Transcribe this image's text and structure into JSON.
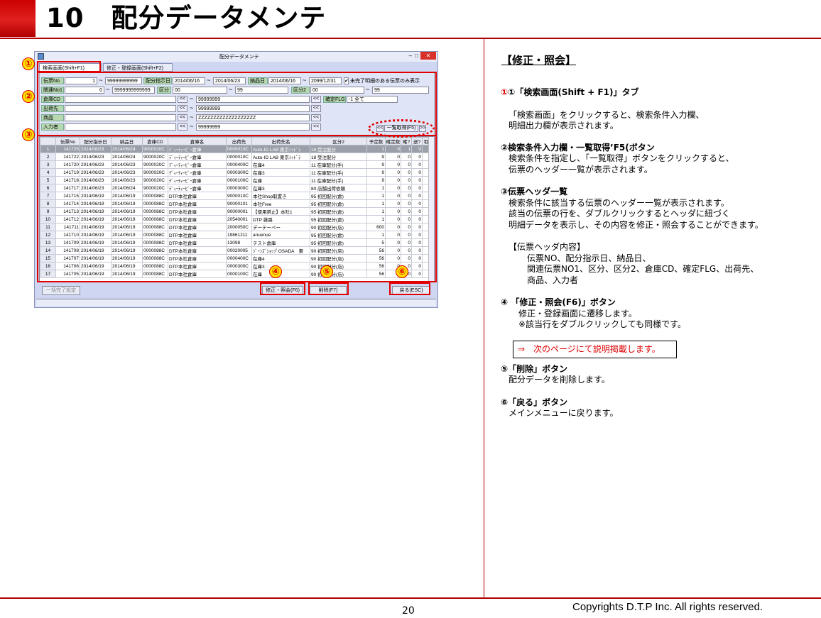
{
  "header": {
    "title": "10　配分データメンテ"
  },
  "footer": {
    "page": "20",
    "copyright": "Copyrights  D.T.P Inc. All rights reserved."
  },
  "window": {
    "title": "配分データメンテ",
    "tabs": [
      "検索画面(Shift+F1)",
      "修正・登録画面(Shift+F2)"
    ],
    "form": {
      "denpyo_label": "伝票No",
      "denpyo_from": "1",
      "denpyo_to": "99999999999",
      "haibun_label": "配分指示日",
      "haibun_from": "2014/06/16",
      "haibun_to": "2014/06/23",
      "nouhin_label": "納品日",
      "nouhin_from": "2014/06/16",
      "nouhin_to": "2099/12/31",
      "check_label": "未完了明細のある伝票のみ表示",
      "kanren_label": "関連No1",
      "kanren_from": "0",
      "kanren_to": "9999999999999",
      "kubun_label": "区分",
      "kubun_from": "00",
      "kubun_to": "99",
      "kubun2_label": "区分2",
      "kubun2_from": "00",
      "kubun2_to": "99",
      "souko_label": "倉庫CD",
      "souko_to": "99999999",
      "kakutei_label": "確定FLG",
      "kakutei_value": "-1 全て",
      "shukka_label": "出荷先",
      "shukka_to": "99999999",
      "shohin_label": "商品",
      "shohin_to": "ZZZZZZZZZZZZZZZZZZZ",
      "nyuryoku_label": "入力者",
      "nyuryoku_to": "99999999",
      "prev": "<<",
      "next": ">>",
      "search_btn": "一覧取得(F5)"
    },
    "grid": {
      "headers": [
        "",
        "伝票No",
        "配分指示日",
        "納品日",
        "倉庫CD",
        "倉庫名",
        "出荷先",
        "出荷先名",
        "区分2",
        "予定数",
        "確定数",
        "確?",
        "送?",
        "取?"
      ],
      "rows": [
        [
          "1",
          "141725",
          "2014/06/23",
          "2014/06/24",
          "9000020C",
          "ﾃﾞｨｰﾃｨｰﾋﾟｰ倉庫",
          "0000010C",
          "Auto-ID LAB 東京ﾐｯﾄﾞﾗ",
          "18 受注配分",
          "1",
          "0",
          "1",
          "0",
          "0"
        ],
        [
          "2",
          "141722",
          "2014/06/23",
          "2014/06/24",
          "9000020C",
          "ﾃﾞｨｰﾃｨｰﾋﾟｰ倉庫",
          "0000010C",
          "Auto-ID LAB 東京ﾐｯﾄﾞﾗ",
          "18 受注配分",
          "9",
          "0",
          "0",
          "0",
          "0"
        ],
        [
          "3",
          "141720",
          "2014/06/23",
          "2014/06/23",
          "9000020C",
          "ﾃﾞｨｰﾃｨｰﾋﾟｰ倉庫",
          "0000400C",
          "在庫4",
          "11 在庫配分(手)",
          "9",
          "0",
          "0",
          "0",
          "0"
        ],
        [
          "4",
          "141719",
          "2014/06/23",
          "2014/06/23",
          "9000020C",
          "ﾃﾞｨｰﾃｨｰﾋﾟｰ倉庫",
          "0000300C",
          "在庫3",
          "11 在庫配分(手)",
          "9",
          "0",
          "0",
          "0",
          "0"
        ],
        [
          "5",
          "141718",
          "2014/06/23",
          "2014/06/23",
          "9000020C",
          "ﾃﾞｨｰﾃｨｰﾋﾟｰ倉庫",
          "0000100C",
          "在庫",
          "11 在庫配分(手)",
          "9",
          "0",
          "0",
          "0",
          "0"
        ],
        [
          "6",
          "141717",
          "2014/06/23",
          "2014/06/24",
          "9000020C",
          "ﾃﾞｨｰﾃｨｰﾋﾟｰ倉庫",
          "0000300C",
          "在庫3",
          "80 店舗出荷依頼",
          "1",
          "0",
          "0",
          "0",
          "0"
        ],
        [
          "7",
          "141715",
          "2014/06/19",
          "2014/06/19",
          "0000088C",
          "DTP本社倉庫",
          "9000010C",
          "本社Shop取置き",
          "95 初回配分(倉)",
          "1",
          "0",
          "0",
          "0",
          "0"
        ],
        [
          "8",
          "141714",
          "2014/06/19",
          "2014/06/19",
          "0000088C",
          "DTP本社倉庫",
          "90000101",
          "本社Free",
          "95 初回配分(倉)",
          "1",
          "0",
          "0",
          "0",
          "0"
        ],
        [
          "9",
          "141713",
          "2014/06/19",
          "2014/06/19",
          "0000088C",
          "DTP本社倉庫",
          "90000001",
          "【使用禁止】本社1",
          "95 初回配分(倉)",
          "1",
          "0",
          "0",
          "0",
          "0"
        ],
        [
          "10",
          "141712",
          "2014/06/19",
          "2014/06/19",
          "0000088C",
          "DTP本社倉庫",
          "20540001",
          "DTP 雑路",
          "95 初回配分(倉)",
          "1",
          "0",
          "0",
          "0",
          "0"
        ],
        [
          "11",
          "141711",
          "2014/06/19",
          "2014/06/19",
          "0000088C",
          "DTP本社倉庫",
          "2000050C",
          "デーテーペー",
          "90 初回配分(店)",
          "600",
          "0",
          "0",
          "0",
          "0"
        ],
        [
          "12",
          "141710",
          "2014/06/19",
          "2014/06/19",
          "0000088C",
          "DTP本社倉庫",
          "19861211",
          "anuenue",
          "95 初回配分(倉)",
          "1",
          "0",
          "0",
          "0",
          "0"
        ],
        [
          "13",
          "141709",
          "2014/06/19",
          "2014/06/19",
          "0000088C",
          "DTP本社倉庫",
          "13098",
          "テスト倉庫",
          "95 初回配分(倉)",
          "5",
          "0",
          "0",
          "0",
          "0"
        ],
        [
          "14",
          "141708",
          "2014/06/19",
          "2014/06/19",
          "0000088C",
          "DTP本社倉庫",
          "00020005",
          "ｼﾞｰﾝｽﾞｼｮｯﾌﾟOSADA　東",
          "90 初回配分(店)",
          "56",
          "0",
          "0",
          "0",
          "0"
        ],
        [
          "15",
          "141707",
          "2014/06/19",
          "2014/06/19",
          "0000088C",
          "DTP本社倉庫",
          "0000400C",
          "在庫4",
          "90 初回配分(店)",
          "56",
          "0",
          "0",
          "0",
          "0"
        ],
        [
          "16",
          "141706",
          "2014/06/19",
          "2014/06/19",
          "0000088C",
          "DTP本社倉庫",
          "0000300C",
          "在庫3",
          "90 初回配分(店)",
          "56",
          "0",
          "0",
          "0",
          "0"
        ],
        [
          "17",
          "141705",
          "2014/06/19",
          "2014/06/19",
          "0000088C",
          "DTP本社倉庫",
          "0000100C",
          "在庫",
          "90 初回配分(店)",
          "56",
          "0",
          "0",
          "0",
          "0"
        ]
      ]
    },
    "buttons": {
      "ikkatsu": "一括完了設定",
      "shusei": "修正・照会(F6)",
      "sakujo": "削除(F7)",
      "modoru": "戻る(ESC)"
    },
    "markers": [
      "①",
      "②",
      "③",
      "④",
      "⑤",
      "⑥"
    ]
  },
  "explain": {
    "heading": "【修正・照会】",
    "s1_title": "①「検索画面(Shift + F1)」タブ",
    "s1_l1": "「検索画面」をクリックすると、検索条件入力欄、",
    "s1_l2": "明細出力欄が表示されます。",
    "s2_title": "②検索条件入力欄・一覧取得’F5(ボタン",
    "s2_l1": "検索条件を指定し、「一覧取得」ボタンをクリックすると、",
    "s2_l2": "伝票のヘッダー一覧が表示されます。",
    "s3_title": "③伝票ヘッダ一覧",
    "s3_l1": "検索条件に該当する伝票のヘッダー一覧が表示されます。",
    "s3_l2": "該当の伝票の行を、ダブルクリックするとヘッダに紐づく",
    "s3_l3": "明細データを表示し、その内容を修正・照会することができます。",
    "s3_l4": "【伝票ヘッダ内容】",
    "s3_l5": "伝票NO、配分指示日、納品日、",
    "s3_l6": "関連伝票NO1、区分、区分2、倉庫CD、確定FLG、出荷先、",
    "s3_l7": "商品、入力者",
    "s4_title": "④ 「修正・照会(F6)」ボタン",
    "s4_l1": "修正・登録画面に遷移します。",
    "s4_l2": "※該当行をダブルクリックしても同様です。",
    "note": "⇒　次のページにて説明掲載します。",
    "s5_title": "⑤「削除」ボタン",
    "s5_l1": "配分データを削除します。",
    "s6_title": "⑥「戻る」ボタン",
    "s6_l1": "メインメニューに戻ります。"
  }
}
